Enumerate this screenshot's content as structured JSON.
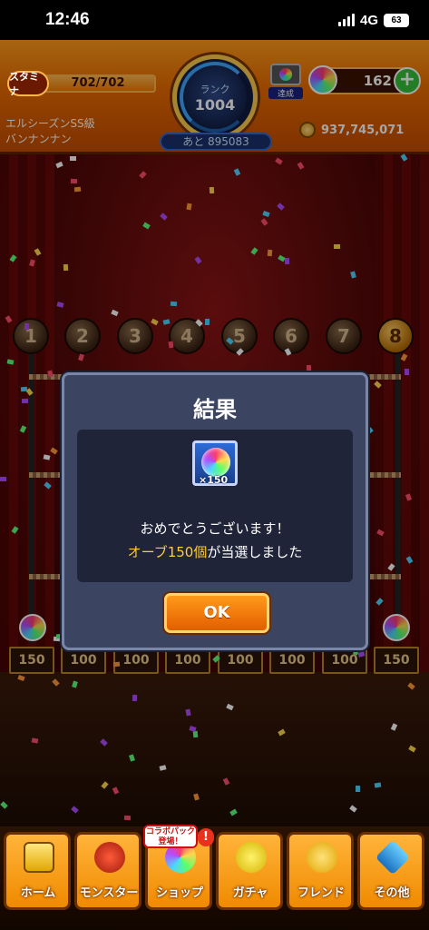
{
  "status_bar": {
    "time": "12:46",
    "network": "4G",
    "battery": "63"
  },
  "header": {
    "stamina_label": "スタミナ",
    "stamina_value": "702/702",
    "stamina_fraction": 1.0,
    "rank_label": "ランク",
    "rank_value": "1004",
    "rank_next": "あと 895083",
    "achievement_label": "達成",
    "orbs": "162",
    "player_rank_title": "エルシーズンSS級",
    "player_name": "バンナンナン",
    "gold": "937,745,071"
  },
  "stage": {
    "numbers": [
      "1",
      "2",
      "3",
      "4",
      "5",
      "6",
      "7",
      "8"
    ],
    "trays": [
      "150",
      "100",
      "100",
      "100",
      "100",
      "100",
      "100",
      "150"
    ]
  },
  "dialog": {
    "title": "結果",
    "item_quantity": "×150",
    "message_line1": "おめでとうございます！",
    "message_highlight": "オーブ150個",
    "message_suffix": "が当選しました",
    "ok_label": "OK"
  },
  "nav": {
    "shop_badge_line1": "コラボパック",
    "shop_badge_line2": "登場！",
    "items": [
      {
        "label": "ホーム",
        "icon": "home-icon"
      },
      {
        "label": "モンスター",
        "icon": "monster-icon"
      },
      {
        "label": "ショップ",
        "icon": "shop-icon"
      },
      {
        "label": "ガチャ",
        "icon": "gacha-icon"
      },
      {
        "label": "フレンド",
        "icon": "friend-icon"
      },
      {
        "label": "その他",
        "icon": "other-icon"
      }
    ]
  }
}
